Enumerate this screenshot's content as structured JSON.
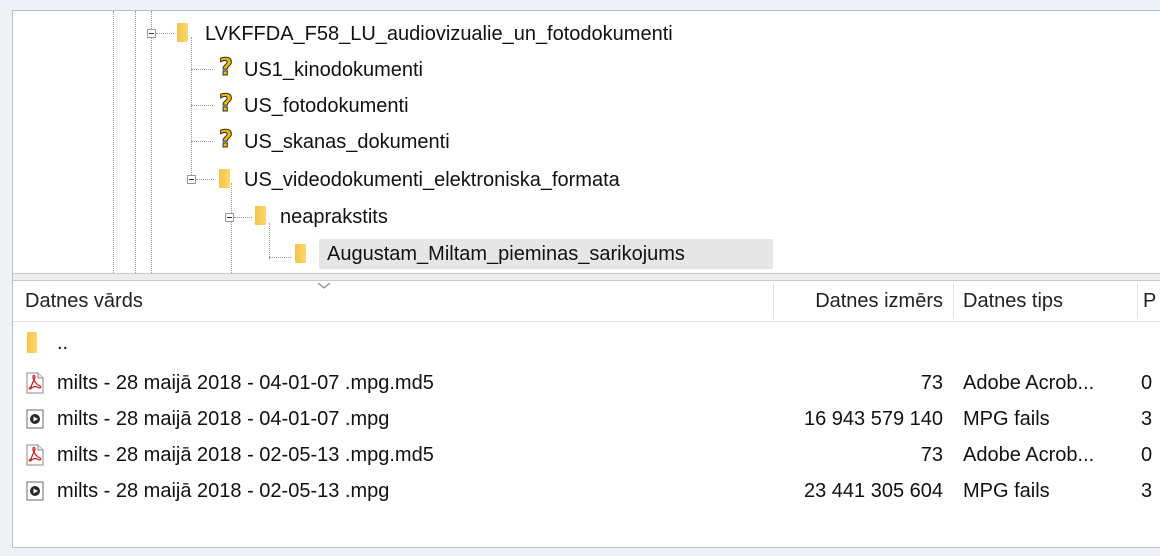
{
  "tree": {
    "nodes": [
      {
        "label": "LVKFFDA_F58_LU_audiovizualie_un_fotodokumenti",
        "icon": "folder-icon",
        "expanded": true
      },
      {
        "label": "US1_kinodokumenti",
        "icon": "question-mark-icon"
      },
      {
        "label": "US_fotodokumenti",
        "icon": "question-mark-icon"
      },
      {
        "label": "US_skanas_dokumenti",
        "icon": "question-mark-icon"
      },
      {
        "label": "US_videodokumenti_elektroniska_formata",
        "icon": "folder-icon",
        "expanded": true
      },
      {
        "label": "neaprakstits",
        "icon": "folder-icon",
        "expanded": true
      },
      {
        "label": "Augustam_Miltam_pieminas_sarikojums",
        "icon": "folder-icon",
        "selected": true
      }
    ]
  },
  "file_list": {
    "columns": {
      "name": "Datnes vārds",
      "size": "Datnes izmērs",
      "type": "Datnes tips",
      "extra": "P"
    },
    "parent_dir": "..",
    "rows": [
      {
        "name": "milts - 28 maijā 2018 - 04-01-07 .mpg.md5",
        "size": "73",
        "type": "Adobe Acrob...",
        "extra": "0",
        "icon": "pdf-file-icon"
      },
      {
        "name": "milts - 28 maijā 2018 - 04-01-07 .mpg",
        "size": "16 943 579 140",
        "type": "MPG fails",
        "extra": "3",
        "icon": "video-file-icon"
      },
      {
        "name": "milts - 28 maijā 2018 - 02-05-13 .mpg.md5",
        "size": "73",
        "type": "Adobe Acrob...",
        "extra": "0",
        "icon": "pdf-file-icon"
      },
      {
        "name": "milts - 28 maijā 2018 - 02-05-13 .mpg",
        "size": "23 441 305 604",
        "type": "MPG fails",
        "extra": "3",
        "icon": "video-file-icon"
      }
    ]
  },
  "colors": {
    "folder": "#ffd86a",
    "question_mark": "#f5b800",
    "pdf_red": "#d32020",
    "selection": "#e6e6e6"
  }
}
